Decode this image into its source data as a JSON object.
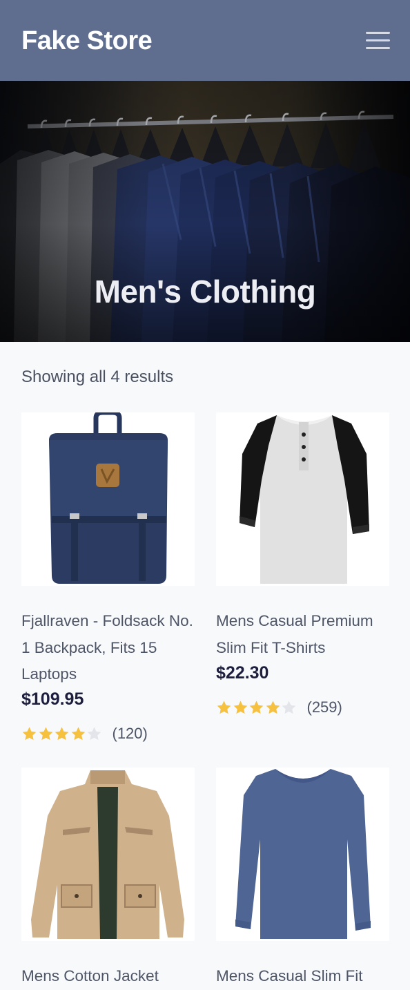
{
  "header": {
    "logo": "Fake Store",
    "menu_icon": "hamburger-menu-icon"
  },
  "hero": {
    "title": "Men's Clothing"
  },
  "results_text": "Showing all 4 results",
  "products": [
    {
      "title": "Fjallraven - Foldsack No. 1 Backpack, Fits 15 Laptops",
      "price": "$109.95",
      "rating": 4,
      "rating_max": 5,
      "count": "(120)",
      "image": "backpack"
    },
    {
      "title": "Mens Casual Premium Slim Fit T-Shirts",
      "price": "$22.30",
      "rating": 4,
      "rating_max": 5,
      "count": "(259)",
      "image": "raglan-tshirt"
    },
    {
      "title": "Mens Cotton Jacket",
      "image": "cotton-jacket"
    },
    {
      "title": "Mens Casual Slim Fit",
      "image": "longsleeve-tshirt"
    }
  ],
  "colors": {
    "header_bg": "#5f6e8f",
    "star_filled": "#f7c140",
    "star_empty": "#e3e5ea",
    "price": "#1e1f3f"
  }
}
